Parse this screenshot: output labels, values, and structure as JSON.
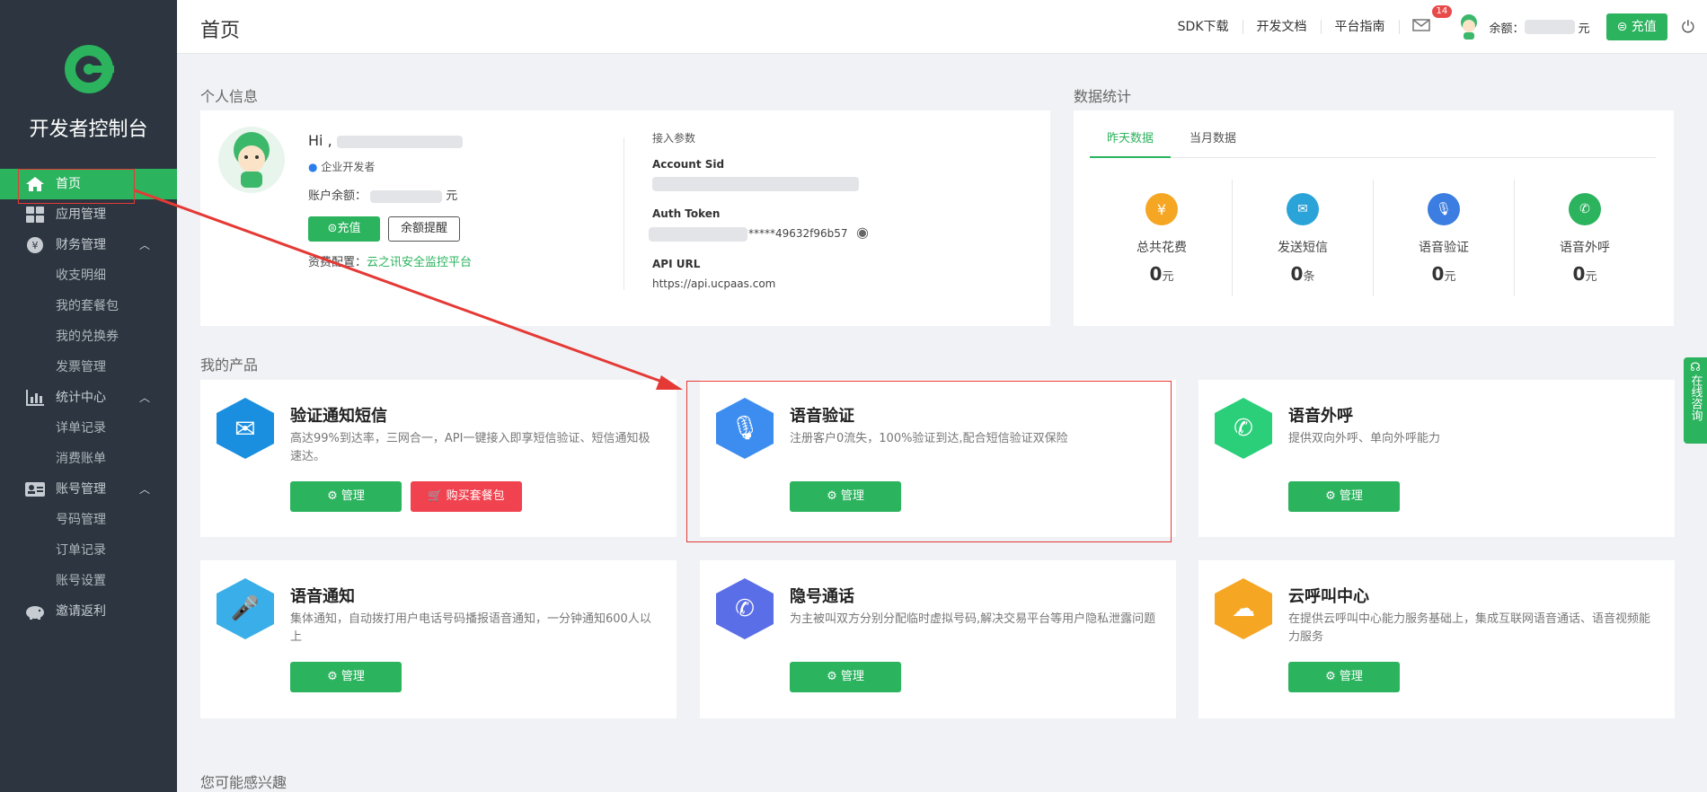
{
  "sidebar": {
    "brand": "开发者控制台",
    "menu": [
      {
        "label": "首页",
        "icon": "home-icon"
      },
      {
        "label": "应用管理",
        "icon": "apps-icon"
      },
      {
        "label": "财务管理",
        "icon": "yen-icon"
      },
      {
        "label": "收支明细"
      },
      {
        "label": "我的套餐包"
      },
      {
        "label": "我的兑换券"
      },
      {
        "label": "发票管理"
      },
      {
        "label": "统计中心",
        "icon": "bar-chart-icon"
      },
      {
        "label": "详单记录"
      },
      {
        "label": "消费账单"
      },
      {
        "label": "账号管理",
        "icon": "id-card-icon"
      },
      {
        "label": "号码管理"
      },
      {
        "label": "订单记录"
      },
      {
        "label": "账号设置"
      },
      {
        "label": "邀请返利",
        "icon": "piggy-bank-icon"
      }
    ]
  },
  "header": {
    "title": "首页",
    "links": [
      "SDK下载",
      "开发文档",
      "平台指南"
    ],
    "mail_badge": "14",
    "balance_label": "余额：",
    "balance_unit": "元",
    "recharge": "充值"
  },
  "personal": {
    "section": "个人信息",
    "greeting": "Hi ,",
    "dev_type": "企业开发者",
    "balance_label": "账户余额：",
    "balance_unit": "元",
    "recharge": "充值",
    "reminder": "余额提醒",
    "config_label": "资费配置：",
    "config_link": "云之讯安全监控平台",
    "params_title": "接入参数",
    "sid_label": "Account Sid",
    "token_label": "Auth Token",
    "token_value": "*****49632f96b57",
    "url_label": "API URL",
    "url_value": "https://api.ucpaas.com"
  },
  "stats": {
    "section": "数据统计",
    "tabs": [
      "昨天数据",
      "当月数据"
    ],
    "items": [
      {
        "label": "总共花费",
        "value": "0",
        "unit": "元",
        "color": "#f5a623"
      },
      {
        "label": "发送短信",
        "value": "0",
        "unit": "条",
        "color": "#2aa4d8"
      },
      {
        "label": "语音验证",
        "value": "0",
        "unit": "元",
        "color": "#3b7de0"
      },
      {
        "label": "语音外呼",
        "value": "0",
        "unit": "元",
        "color": "#2bb35e"
      }
    ]
  },
  "products": {
    "section": "我的产品",
    "manage": "管理",
    "buy": "购买套餐包",
    "items": [
      {
        "name": "验证通知短信",
        "desc": "高达99%到达率，三网合一，API一键接入即享短信验证、短信通知极速达。",
        "color": "#1a8fe0"
      },
      {
        "name": "语音验证",
        "desc": "注册客户0流失，100%验证到达,配合短信验证双保险",
        "color": "#3d8df0"
      },
      {
        "name": "语音外呼",
        "desc": "提供双向外呼、单向外呼能力",
        "color": "#2bcf7a"
      },
      {
        "name": "语音通知",
        "desc": "集体通知，自动拨打用户电话号码播报语音通知，一分钟通知600人以上",
        "color": "#3aaee8"
      },
      {
        "name": "隐号通话",
        "desc": "为主被叫双方分别分配临时虚拟号码,解决交易平台等用户隐私泄露问题",
        "color": "#5a6ee8"
      },
      {
        "name": "云呼叫中心",
        "desc": "在提供云呼叫中心能力服务基础上，集成互联网语音通话、语音视频能力服务",
        "color": "#f5a623"
      }
    ]
  },
  "interest": {
    "section": "您可能感兴趣"
  },
  "chat": {
    "label": "在线咨询"
  }
}
